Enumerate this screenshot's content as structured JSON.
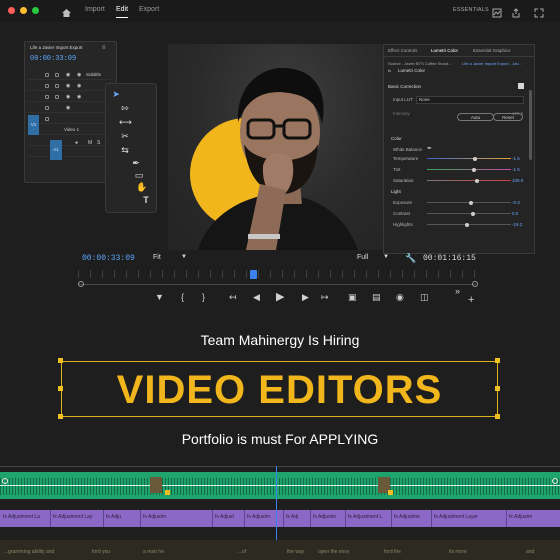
{
  "topbar": {
    "nav": [
      "Import",
      "Edit",
      "Export"
    ],
    "active": "Edit",
    "workspace": "ESSENTIALS",
    "dot_colors": [
      "#ff5f57",
      "#febc2e",
      "#28c840"
    ]
  },
  "timeline_panel": {
    "title": "Life a Javier Import Export",
    "timecode": "00:00:33:09",
    "tracks": [
      "Subtitle",
      "V1",
      "Video 1",
      "A1"
    ]
  },
  "lumetri": {
    "tabs": [
      "Effect Controls",
      "Lumetri Color",
      "Essential Graphics"
    ],
    "source": "Source - Javier BTS Coffee Shoot...",
    "sequence": "Life a Javier Import Export - Jav...",
    "effect": "Lumetri Color",
    "basic_correction": "Basic Correction",
    "input_lut_label": "Input LUT",
    "input_lut_value": "None",
    "intensity_label": "Intensity",
    "intensity_value": "100.0",
    "auto": "Auto",
    "reset": "Reset",
    "color_section": "Color",
    "white_balance": "White Balance",
    "color_rows": [
      {
        "label": "Temperature",
        "value": "-1.5",
        "pos": 0.57
      },
      {
        "label": "Tint",
        "value": "-1.5",
        "pos": 0.56
      },
      {
        "label": "Saturation",
        "value": "100.0",
        "pos": 0.6
      }
    ],
    "light_section": "Light",
    "light_rows": [
      {
        "label": "Exposure",
        "value": "-0.3",
        "pos": 0.52
      },
      {
        "label": "Contrast",
        "value": "0.0",
        "pos": 0.55
      },
      {
        "label": "Highlights",
        "value": "-19.2",
        "pos": 0.48
      }
    ]
  },
  "monitor": {
    "timecode_current": "00:00:33:09",
    "fit": "Fit",
    "quality": "Full",
    "timecode_total": "00:01:16:15",
    "playhead": 0.44
  },
  "headline": {
    "team": "Team Mahinergy Is Hiring",
    "title": "VIDEO EDITORS",
    "subtitle": "Portfolio is must For APPLYING"
  },
  "timeline": {
    "adjustment_labels": [
      "fx Adjustment La",
      "fx Adjustment Lay",
      "fx Adju",
      "fx Adjustm",
      "fx Adjust",
      "fx Adjustm",
      "fx Adj",
      "fx Adjustm",
      "fx Adjustment L",
      "fx Adjustme",
      "fx Adjustment Layer",
      "fx Adjustm"
    ],
    "caption_labels": [
      "...gramming ability and",
      "ford you",
      "a man he",
      "...of",
      "the way",
      "open the envy",
      "ford the",
      "its more",
      "and"
    ],
    "accent": "#1fa46e",
    "adjustment_color": "#8c68c6",
    "title_color": "#f2b61d"
  }
}
